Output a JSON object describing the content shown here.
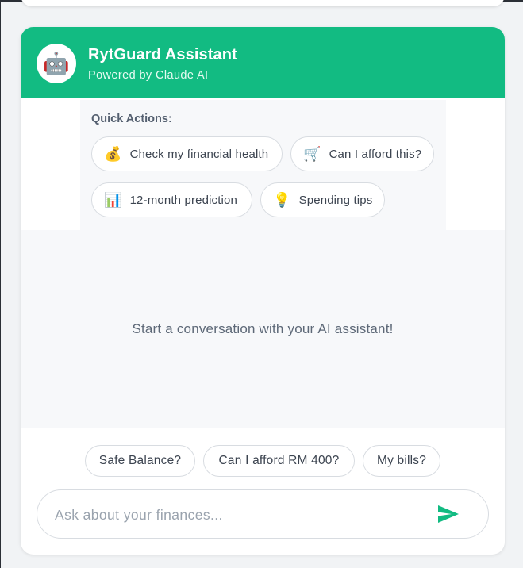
{
  "assistant": {
    "avatar_icon": "robot-icon",
    "avatar_glyph": "🤖",
    "title": "RytGuard Assistant",
    "subtitle": "Powered by Claude AI",
    "accent_color": "#12bb82"
  },
  "quick_actions": {
    "label": "Quick Actions:",
    "items": [
      {
        "icon": "money-bag-icon",
        "glyph": "💰",
        "label": "Check my financial health"
      },
      {
        "icon": "shopping-cart-icon",
        "glyph": "🛒",
        "label": "Can I afford this?"
      },
      {
        "icon": "bar-chart-icon",
        "glyph": "📊",
        "label": "12-month prediction"
      },
      {
        "icon": "light-bulb-icon",
        "glyph": "💡",
        "label": "Spending tips"
      }
    ]
  },
  "chat": {
    "empty_message": "Start a conversation with your AI assistant!"
  },
  "suggestions": [
    "Safe Balance?",
    "Can I afford RM 400?",
    "My bills?"
  ],
  "input": {
    "placeholder": "Ask about your finances...",
    "value": "",
    "send_icon": "send-icon"
  }
}
